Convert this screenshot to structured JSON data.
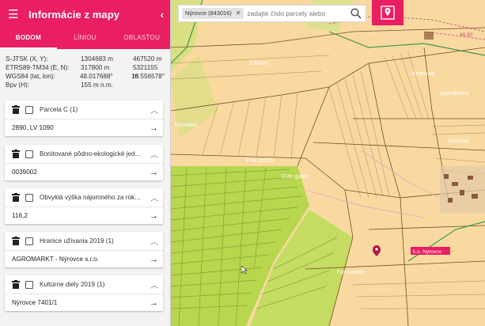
{
  "header": {
    "title": "Informácie z mapy",
    "menu_icon": "menu-icon",
    "collapse_icon": "chevron-left-icon"
  },
  "tabs": [
    {
      "label": "BODOM",
      "active": true
    },
    {
      "label": "LÍNIOU",
      "active": false
    },
    {
      "label": "OBLASŤOU",
      "active": false
    }
  ],
  "coords": [
    {
      "label": "S-JTSK (X, Y):",
      "v1": "1304683 m",
      "v2": "467520 m"
    },
    {
      "label": "ETRS89-TM34 (E, N):",
      "v1": "317800 m",
      "v2": "5321155 m"
    },
    {
      "label": "WGS84 (lat, lon):",
      "v1": "48.017688°",
      "v2": "18.556578°"
    },
    {
      "label": "Bpv (H):",
      "v1": "155 m n.m.",
      "v2": ""
    }
  ],
  "cards": [
    {
      "title": "Parcela C (1)",
      "value": "2890, LV 1090"
    },
    {
      "title": "Bonitované pôdno-ekologické jed…",
      "value": "0039002"
    },
    {
      "title": "Obvyklá výška nájomného za rok…",
      "value": "116,2"
    },
    {
      "title": "Hranice užívania 2019 (1)",
      "value": "AGROMARKT - Nýrovce s.r.o."
    },
    {
      "title": "Kultúrne diely 2019 (1)",
      "value": "Nýrovce 7401/1"
    }
  ],
  "search": {
    "chip": "Nýrovce (843016)",
    "placeholder": "zadajte číslo parcely alebo"
  },
  "map": {
    "labels": {
      "town": "k.ú. Nýrovce",
      "field_1": "Farmanske",
      "field_2": "Nyárasd",
      "field_3": "Pole pomôr",
      "field_4": "Cutu gyare",
      "field_5": "Ciklevé",
      "field_6": "Kiszmala",
      "field_7": "Apaudlvany",
      "field_8": "Nyíroldai",
      "field_9": "90-82"
    }
  },
  "colors": {
    "accent": "#e91e63",
    "parcel": "#f9d9a0",
    "field_green": "#b8d64e"
  }
}
